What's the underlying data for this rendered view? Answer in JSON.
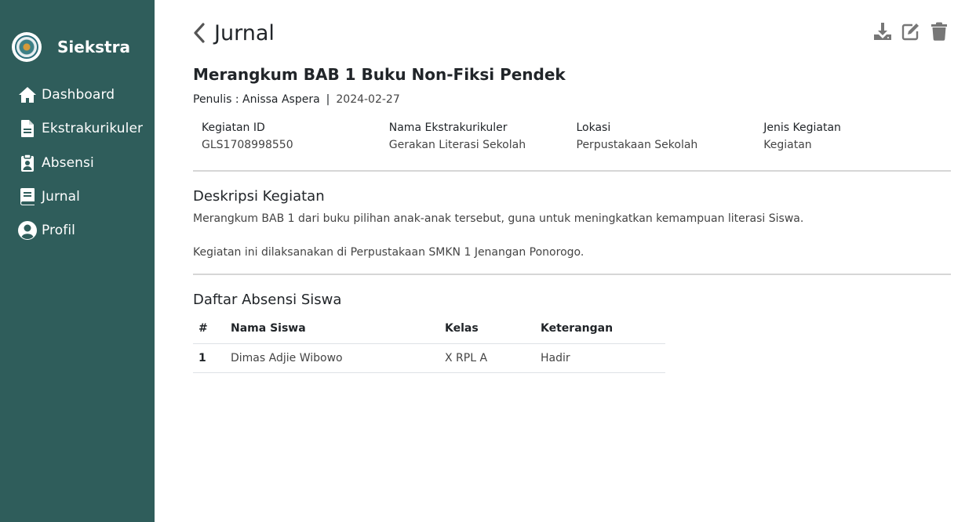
{
  "brand": {
    "name": "Siekstra"
  },
  "sidebar": {
    "items": [
      {
        "label": "Dashboard",
        "icon": "home-icon"
      },
      {
        "label": "Ekstrakurikuler",
        "icon": "file-icon"
      },
      {
        "label": "Absensi",
        "icon": "clipboard-user-icon"
      },
      {
        "label": "Jurnal",
        "icon": "book-icon"
      },
      {
        "label": "Profil",
        "icon": "user-circle-icon"
      }
    ]
  },
  "header": {
    "title": "Jurnal",
    "actions": [
      "download-icon",
      "edit-icon",
      "trash-icon"
    ]
  },
  "journal": {
    "title": "Merangkum BAB 1 Buku Non-Fiksi Pendek",
    "author": "Penulis : Anissa Aspera",
    "separator": "|",
    "date": "2024-02-27"
  },
  "info": [
    {
      "label": "Kegiatan ID",
      "value": "GLS1708998550"
    },
    {
      "label": "Nama Ekstrakurikuler",
      "value": "Gerakan Literasi Sekolah"
    },
    {
      "label": "Lokasi",
      "value": "Perpustakaan Sekolah"
    },
    {
      "label": "Jenis Kegiatan",
      "value": "Kegiatan"
    }
  ],
  "description": {
    "heading": "Deskripsi Kegiatan",
    "line1": "Merangkum BAB 1 dari buku pilihan anak-anak tersebut, guna untuk meningkatkan kemampuan literasi Siswa.",
    "line2": "Kegiatan ini dilaksanakan di Perpustakaan SMKN 1 Jenangan Ponorogo."
  },
  "attendance": {
    "heading": "Daftar Absensi Siswa",
    "columns": [
      "#",
      "Nama Siswa",
      "Kelas",
      "Keterangan"
    ],
    "rows": [
      {
        "no": "1",
        "name": "Dimas Adjie Wibowo",
        "kelas": "X RPL A",
        "keterangan": "Hadir"
      }
    ]
  },
  "colors": {
    "sidebar": "#2f5d5b",
    "icon_gray": "#777777"
  }
}
